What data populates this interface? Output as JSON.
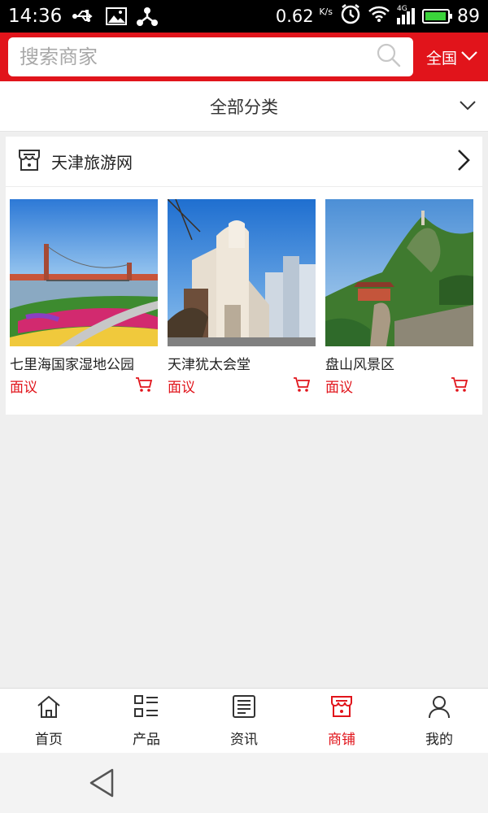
{
  "status_bar": {
    "time": "14:36",
    "speed_value": "0.62",
    "speed_unit": "K/s",
    "network": "4G",
    "battery": "89"
  },
  "header": {
    "search_placeholder": "搜索商家",
    "region": "全国"
  },
  "category_bar": {
    "label": "全部分类"
  },
  "shop": {
    "name": "天津旅游网",
    "items": [
      {
        "title": "七里海国家湿地公园",
        "price": "面议"
      },
      {
        "title": "天津犹太会堂",
        "price": "面议"
      },
      {
        "title": "盘山风景区",
        "price": "面议"
      }
    ]
  },
  "tabs": [
    {
      "label": "首页",
      "icon": "home-icon"
    },
    {
      "label": "产品",
      "icon": "list-icon"
    },
    {
      "label": "资讯",
      "icon": "news-icon"
    },
    {
      "label": "商铺",
      "icon": "shop-icon",
      "active": true
    },
    {
      "label": "我的",
      "icon": "user-icon"
    }
  ],
  "colors": {
    "brand_red": "#e1141b",
    "background": "#efefef"
  }
}
